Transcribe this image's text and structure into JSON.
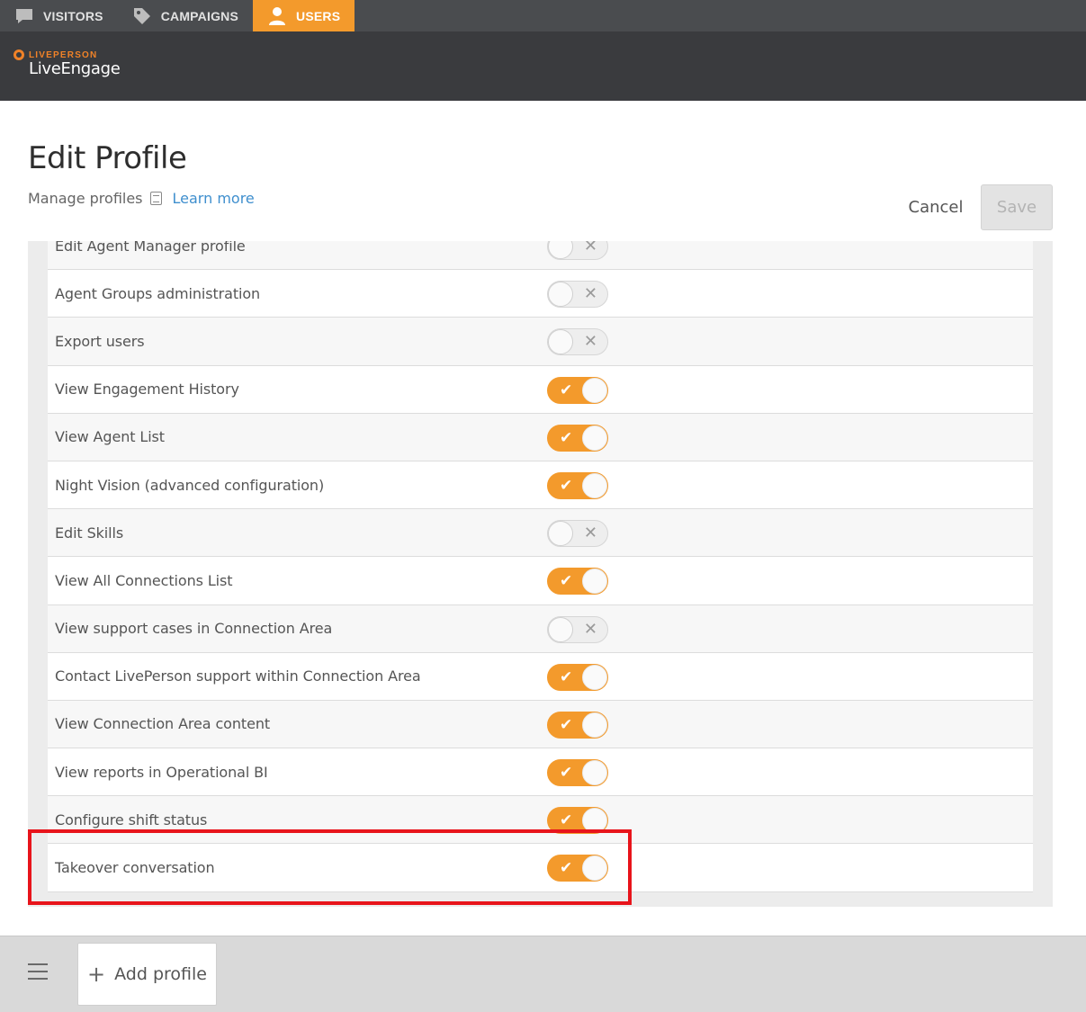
{
  "topnav": {
    "tabs": [
      {
        "label": "VISITORS",
        "icon": "chat-bubble-icon"
      },
      {
        "label": "CAMPAIGNS",
        "icon": "tag-icon"
      },
      {
        "label": "USERS",
        "icon": "user-icon"
      }
    ],
    "active_tab": "USERS"
  },
  "header": {
    "brand": "LIVEPERSON",
    "product": "LiveEngage"
  },
  "page": {
    "title": "Edit Profile",
    "subtitle": "Manage profiles",
    "learn_more": "Learn more",
    "cancel_label": "Cancel",
    "save_label": "Save"
  },
  "permissions": [
    {
      "label": "Edit Agent Manager profile",
      "enabled": false
    },
    {
      "label": "Agent Groups administration",
      "enabled": false
    },
    {
      "label": "Export users",
      "enabled": false
    },
    {
      "label": "View Engagement History",
      "enabled": true
    },
    {
      "label": "View Agent List",
      "enabled": true
    },
    {
      "label": "Night Vision (advanced configuration)",
      "enabled": true
    },
    {
      "label": "Edit Skills",
      "enabled": false
    },
    {
      "label": "View All Connections List",
      "enabled": true
    },
    {
      "label": "View support cases in Connection Area",
      "enabled": false
    },
    {
      "label": "Contact LivePerson support within Connection Area",
      "enabled": true
    },
    {
      "label": "View Connection Area content",
      "enabled": true
    },
    {
      "label": "View reports in Operational BI",
      "enabled": true
    },
    {
      "label": "Configure shift status",
      "enabled": true
    },
    {
      "label": "Takeover conversation",
      "enabled": true
    }
  ],
  "highlighted_row": "Takeover conversation",
  "footer": {
    "add_profile_label": "Add profile"
  },
  "colors": {
    "accent": "#f39a2c",
    "header_bg": "#3a3b3e",
    "tabbar_bg": "#4a4c4f",
    "link": "#3f8fce",
    "highlight": "#e8141b"
  }
}
